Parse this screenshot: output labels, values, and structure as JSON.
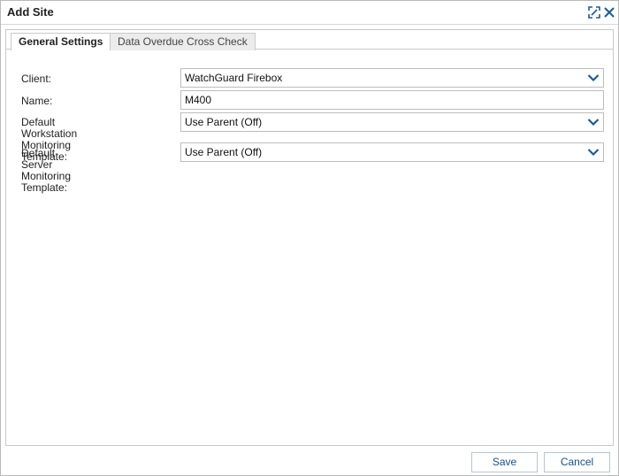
{
  "dialog": {
    "title": "Add Site",
    "icons": {
      "expand": "expand-icon",
      "close": "close-icon"
    }
  },
  "tabs": [
    {
      "label": "General Settings",
      "active": true
    },
    {
      "label": "Data Overdue Cross Check",
      "active": false
    }
  ],
  "form": {
    "client": {
      "label": "Client:",
      "value": "WatchGuard Firebox"
    },
    "name": {
      "label": "Name:",
      "value": "M400"
    },
    "workstation_template": {
      "label_line1": "Default Workstation Monitoring",
      "label_line2": "Template:",
      "value": "Use Parent (Off)"
    },
    "server_template": {
      "label_line1": "Default Server Monitoring",
      "label_line2": "Template:",
      "value": "Use Parent (Off)"
    }
  },
  "footer": {
    "save_label": "Save",
    "cancel_label": "Cancel"
  },
  "colors": {
    "accent": "#1d5a99",
    "button_text": "#1d4f86",
    "border": "#c9c9c9"
  }
}
